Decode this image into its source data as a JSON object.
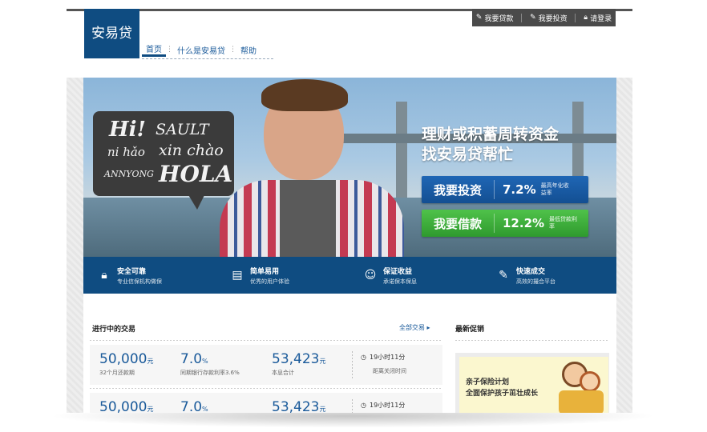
{
  "logo": {
    "text": "安易贷"
  },
  "userbar": {
    "borrow": "我要贷款",
    "invest": "我要投资",
    "login": "请登录"
  },
  "nav": {
    "home": "首页",
    "about": "什么是安易贷",
    "help": "帮助"
  },
  "banner": {
    "sign": {
      "l1": "Hi!",
      "l2": "SAULT",
      "l3": "ni hǎo",
      "l4": "xin chào",
      "l5": "ANNYONG",
      "l6": "HOLA"
    },
    "headline1": "理财或积蓄周转资金",
    "headline2": "找安易贷帮忙",
    "invest": {
      "label": "我要投资",
      "rate": "7.2%",
      "sub": "最高年化收益率"
    },
    "borrow": {
      "label": "我要借款",
      "rate": "12.2%",
      "sub": "最低贷款利率"
    }
  },
  "features": [
    {
      "icon": "lock-icon",
      "title": "安全可靠",
      "sub": "专业信保机构做保"
    },
    {
      "icon": "document-icon",
      "title": "简单易用",
      "sub": "优秀的用户体验"
    },
    {
      "icon": "smile-icon",
      "title": "保证收益",
      "sub": "承诺保本保息"
    },
    {
      "icon": "pencil-icon",
      "title": "快速成交",
      "sub": "高效的撮合平台"
    }
  ],
  "deals": {
    "title": "进行中的交易",
    "all_link": "全部交易",
    "rows": [
      {
        "amount": "50,000",
        "amount_unit": "元",
        "amount_cap": "32个月还款期",
        "rate": "7.0",
        "rate_unit": "%",
        "rate_cap": "同期银行存款利率3.6%",
        "total": "53,423",
        "total_unit": "元",
        "total_cap": "本息合计",
        "time": "19小时11分",
        "time_cap": "距离关闭时间"
      },
      {
        "amount": "50,000",
        "amount_unit": "元",
        "rate": "7.0",
        "rate_unit": "%",
        "total": "53,423",
        "total_unit": "元",
        "time": "19小时11分"
      }
    ]
  },
  "promo": {
    "title": "最新促销",
    "line1": "亲子保险计划",
    "line2": "全面保护孩子茁壮成长"
  },
  "colors": {
    "brand": "#0f4c81",
    "invest": "#1a5fae",
    "borrow": "#3fae3b",
    "link": "#1a5a9a"
  }
}
